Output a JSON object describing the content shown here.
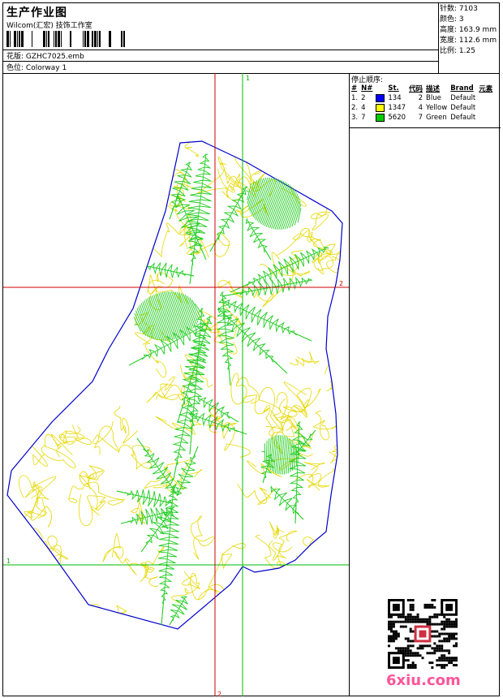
{
  "header": {
    "title": "生产作业图",
    "company": "Wilcom(汇宏) 技饰工作室",
    "design_label": "花版:",
    "design_value": "GZHC7025.emb",
    "colorway_label": "色位:",
    "colorway_value": "Colorway 1"
  },
  "stats": {
    "stitches_label": "针数:",
    "stitches_value": "7103",
    "colors_label": "颜色:",
    "colors_value": "3",
    "height_label": "高度:",
    "height_value": "163.9 mm",
    "width_label": "宽度:",
    "width_value": "112.6 mm",
    "scale_label": "比例:",
    "scale_value": "1.25"
  },
  "stop_sequence": {
    "title": "停止顺序:",
    "headers": [
      "#",
      "N#",
      "St.",
      "代码",
      "描述",
      "Brand",
      "元素"
    ],
    "rows": [
      {
        "idx": "1.",
        "n": "2",
        "color": "#0000ff",
        "st": "134",
        "code": "2",
        "desc": "Blue",
        "brand": "Default"
      },
      {
        "idx": "2.",
        "n": "4",
        "color": "#ffff00",
        "st": "1347",
        "code": "4",
        "desc": "Yellow",
        "brand": "Default"
      },
      {
        "idx": "3.",
        "n": "7",
        "color": "#00cc00",
        "st": "5620",
        "code": "7",
        "desc": "Green",
        "brand": "Default"
      }
    ]
  },
  "guides": {
    "v_red": "2",
    "h_red": "2",
    "v_green": "1",
    "h_green": "1"
  },
  "colors": {
    "outline": "#0000cc",
    "fill": "#e6d800",
    "leaf": "#22cc22",
    "guide_red": "#cc0000",
    "guide_green": "#00bb00"
  },
  "watermark": "6xiu.com"
}
